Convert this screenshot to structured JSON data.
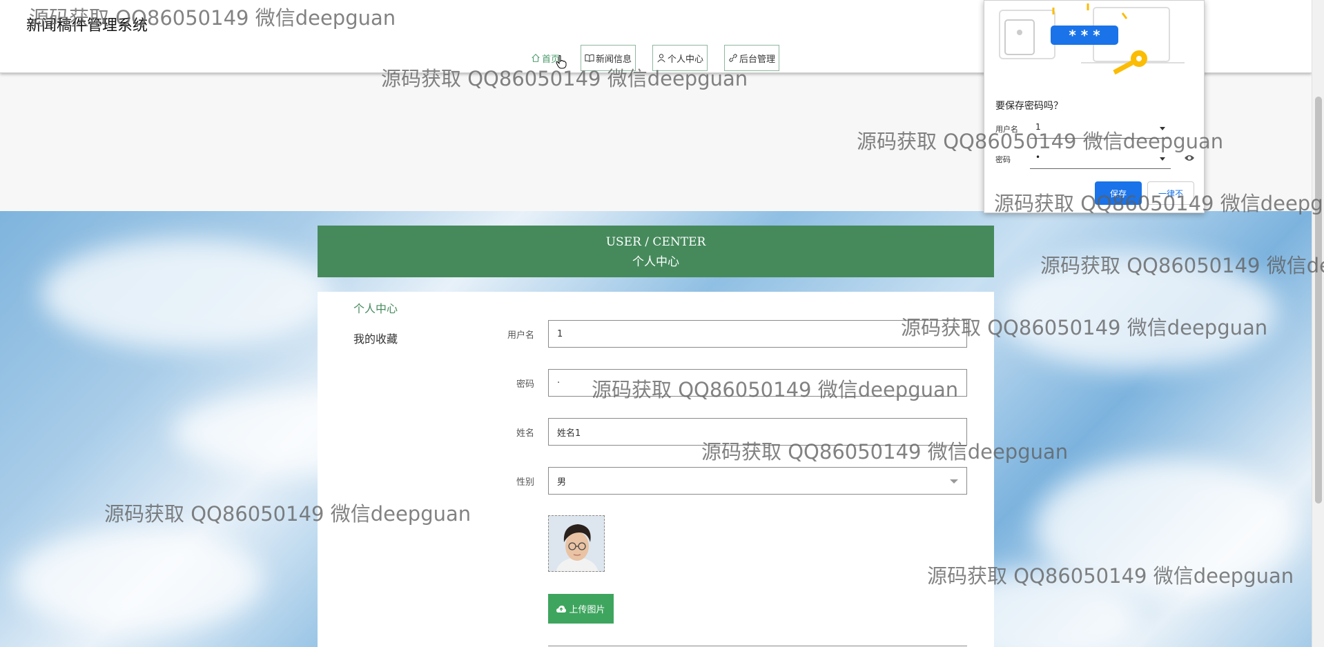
{
  "header": {
    "site_title": "新闻稿件管理系统",
    "nav": [
      {
        "label": "首页",
        "icon": "home-icon"
      },
      {
        "label": "新闻信息",
        "icon": "book-icon"
      },
      {
        "label": "个人中心",
        "icon": "user-icon"
      },
      {
        "label": "后台管理",
        "icon": "link-icon"
      }
    ]
  },
  "panel": {
    "title_en": "USER / CENTER",
    "title_cn": "个人中心",
    "sidebar": [
      {
        "label": "个人中心"
      },
      {
        "label": "我的收藏"
      }
    ]
  },
  "form": {
    "username_label": "用户名",
    "username_value": "1",
    "password_label": "密码",
    "password_value": "·",
    "name_label": "姓名",
    "name_value": "姓名1",
    "gender_label": "性别",
    "gender_value": "男",
    "upload_label": "上传图片"
  },
  "password_popup": {
    "title": "要保存密码吗？",
    "username_label": "用户名",
    "username_value": "1",
    "password_label": "密码",
    "password_value": "•",
    "save_label": "保存",
    "never_label": "一律不",
    "graphic_text": "* * *"
  },
  "watermark": {
    "text": "源码获取 QQ86050149 微信deepguan"
  },
  "colors": {
    "accent": "#468a5c",
    "upload_button": "#3ea55e",
    "save_button": "#1a73e8"
  }
}
